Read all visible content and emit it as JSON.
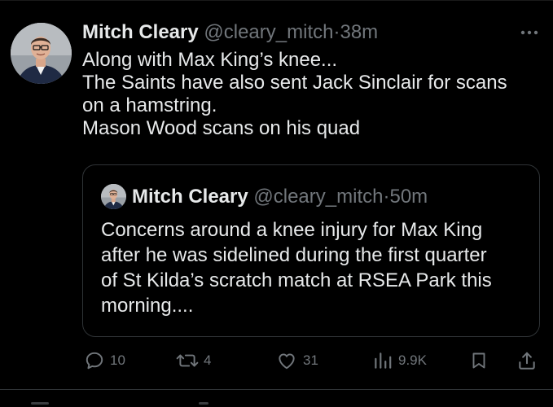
{
  "tweet": {
    "author_name": "Mitch Cleary",
    "author_handle": "@cleary_mitch",
    "separator": "·",
    "time_ago": "38m",
    "more_icon": "more-horizontal-icon",
    "text_lines": [
      "Along with Max King’s knee...",
      "The Saints have also sent Jack Sinclair for scans",
      "on a hamstring.",
      "Mason Wood scans on his quad"
    ]
  },
  "quoted_tweet": {
    "author_name": "Mitch Cleary",
    "author_handle": "@cleary_mitch",
    "separator": "·",
    "time_ago": "50m",
    "text_lines": [
      "Concerns around a knee injury for Max King",
      "after he was sidelined during the first quarter",
      "of St Kilda’s scratch match at RSEA Park this",
      "morning...."
    ]
  },
  "actions": {
    "reply": {
      "icon": "reply-icon",
      "count": "10"
    },
    "retweet": {
      "icon": "retweet-icon",
      "count": "4"
    },
    "like": {
      "icon": "heart-icon",
      "count": "31"
    },
    "views": {
      "icon": "views-chart-icon",
      "count": "9.9K"
    },
    "bookmark": {
      "icon": "bookmark-icon"
    },
    "share": {
      "icon": "share-icon"
    }
  },
  "colors": {
    "background": "#000000",
    "text_primary": "#e7e9ea",
    "text_secondary": "#71767b",
    "border": "#2f3336"
  }
}
